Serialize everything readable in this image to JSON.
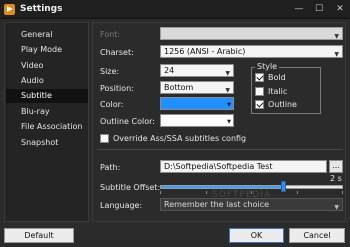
{
  "window": {
    "title": "Settings",
    "controls": {
      "minimize": "—",
      "maximize": "☐",
      "close": "✕"
    }
  },
  "sidebar": {
    "items": [
      {
        "label": "General"
      },
      {
        "label": "Play Mode"
      },
      {
        "label": "Video"
      },
      {
        "label": "Audio"
      },
      {
        "label": "Subtitle",
        "selected": true
      },
      {
        "label": "Blu-ray"
      },
      {
        "label": "File Association"
      },
      {
        "label": "Snapshot"
      }
    ]
  },
  "subtitle": {
    "font": {
      "label": "Font:",
      "value": ""
    },
    "charset": {
      "label": "Charset:",
      "value": "1256  (ANSI - Arabic)"
    },
    "size": {
      "label": "Size:",
      "value": "24"
    },
    "position": {
      "label": "Position:",
      "value": "Bottom"
    },
    "color": {
      "label": "Color:",
      "value_hex": "#1e90ff"
    },
    "outline_color": {
      "label": "Outline Color:",
      "value_hex": "#ffffff"
    },
    "style": {
      "legend": "Style",
      "bold": {
        "label": "Bold",
        "checked": true
      },
      "italic": {
        "label": "Italic",
        "checked": false
      },
      "outline": {
        "label": "Outline",
        "checked": true
      }
    },
    "override": {
      "label": "Override Ass/SSA subtitles config",
      "checked": false
    },
    "path": {
      "label": "Path:",
      "value": "D:\\Softpedia\\Softpedia Test",
      "browse_label": "..."
    },
    "offset": {
      "label": "Subtitle Offset:",
      "value_text": "2 s",
      "level_fraction": 0.67
    },
    "language": {
      "label": "Language:",
      "value": "Remember the last choice"
    }
  },
  "footer": {
    "default_label": "Default",
    "ok_label": "OK",
    "cancel_label": "Cancel"
  },
  "watermark": "SOFTPEDIA",
  "colors": {
    "accent": "#3a8de0",
    "background": "#2b2b2b",
    "selection": "#111111"
  }
}
